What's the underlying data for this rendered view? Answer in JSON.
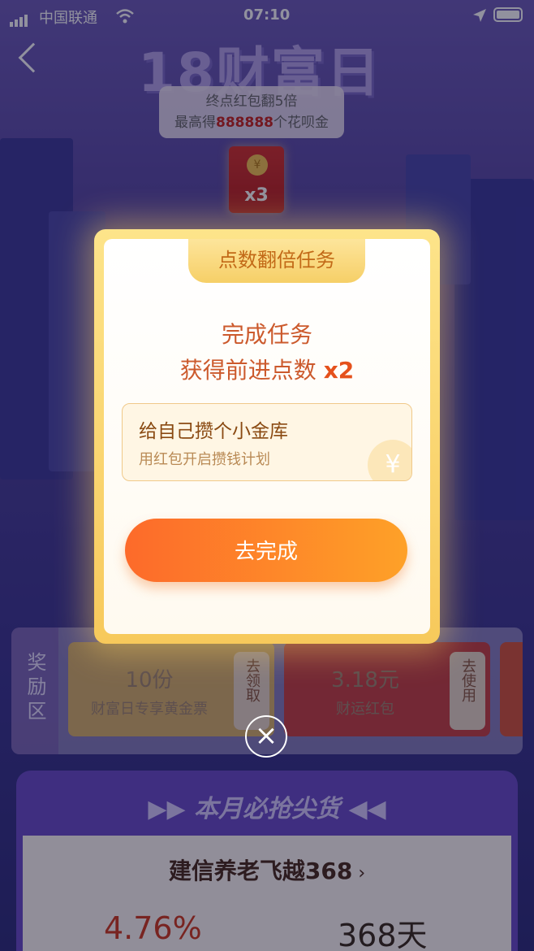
{
  "status": {
    "carrier": "中国联通",
    "time": "07:10"
  },
  "hero": {
    "title": "18财富日",
    "line1": "终点红包翻5倍",
    "line2_prefix": "最高得",
    "line2_amount": "888888",
    "line2_suffix": "个花呗金",
    "multiplier": "x3"
  },
  "modal": {
    "ribbon": "点数翻倍任务",
    "heading": "完成任务",
    "sub_text": "获得前进点数",
    "sub_multiplier": "x2",
    "task": {
      "title": "给自己攒个小金库",
      "desc": "用红包开启攒钱计划"
    },
    "button": "去完成"
  },
  "rewards": {
    "label": "奖励区",
    "items": [
      {
        "value": "10份",
        "desc": "财富日专享黄金票",
        "action": "去领取"
      },
      {
        "value": "3.18元",
        "desc": "财运红包",
        "action": "去使用"
      }
    ]
  },
  "section": {
    "title": "本月必抢尖货",
    "product": "建信养老飞越368",
    "rate": "4.76%",
    "days": "368天"
  },
  "colors": {
    "accent": "#fd6a2a",
    "gold": "#f7c95b"
  }
}
